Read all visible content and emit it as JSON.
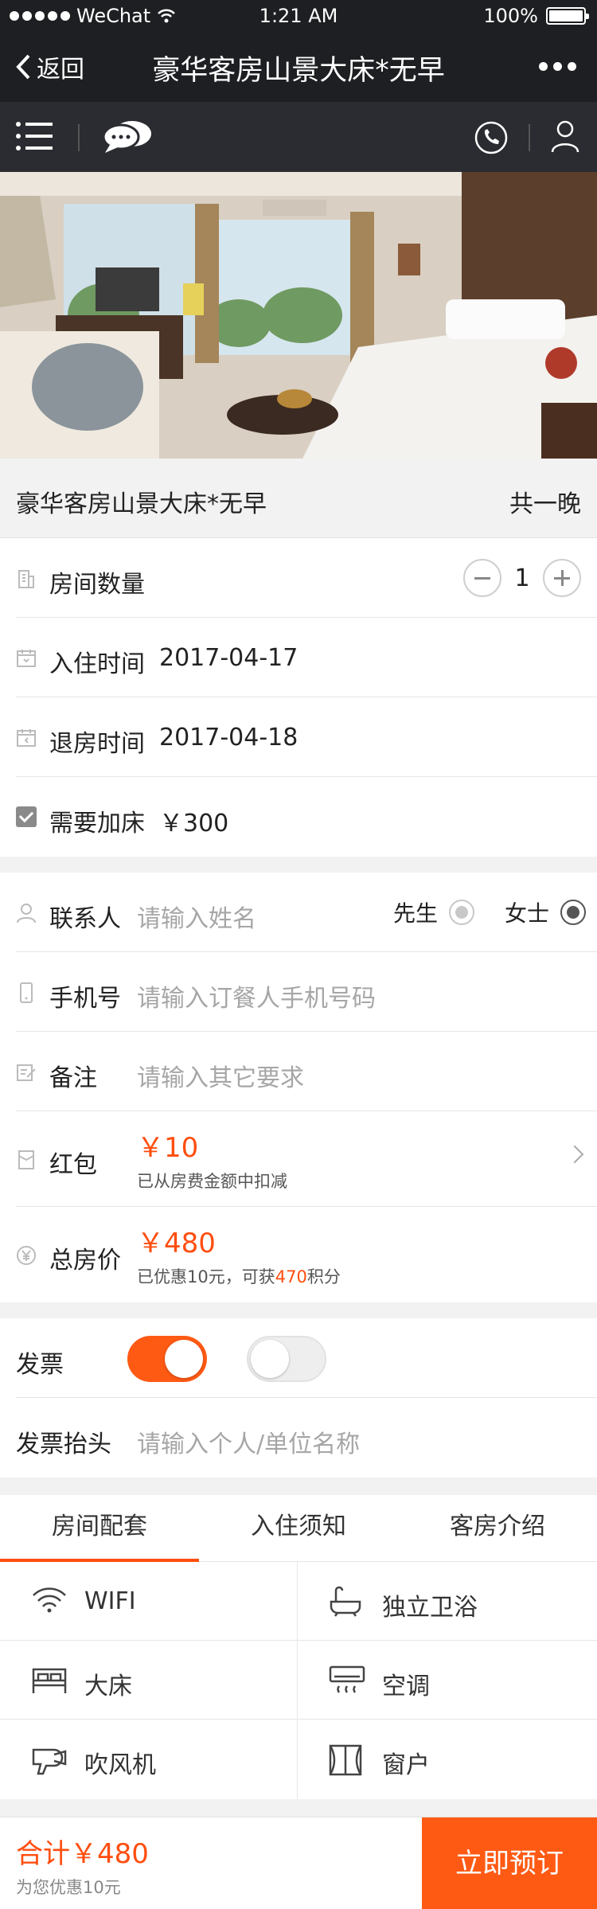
{
  "status": {
    "carrier": "WeChat",
    "time": "1:21 AM",
    "battery": "100%"
  },
  "nav": {
    "back_label": "返回",
    "title": "豪华客房山景大床*无早"
  },
  "room": {
    "name": "豪华客房山景大床*无早",
    "nights": "共一晚"
  },
  "booking": {
    "quantity_label": "房间数量",
    "quantity": "1",
    "checkin_label": "入住时间",
    "checkin_date": "2017-04-17",
    "checkout_label": "退房时间",
    "checkout_date": "2017-04-18",
    "extra_bed_label": "需要加床",
    "extra_bed_price": "￥300",
    "extra_bed_checked": true
  },
  "contact": {
    "name_label": "联系人",
    "name_placeholder": "请输入姓名",
    "gender_male": "先生",
    "gender_female": "女士",
    "gender_selected": "女士",
    "phone_label": "手机号",
    "phone_placeholder": "请输入订餐人手机号码",
    "note_label": "备注",
    "note_placeholder": "请输入其它要求",
    "coupon_label": "红包",
    "coupon_amount": "￥10",
    "coupon_note": "已从房费金额中扣减",
    "total_label": "总房价",
    "total_amount": "￥480",
    "total_note_prefix": "已优惠10元，可获",
    "total_points": "470",
    "total_note_suffix": "积分"
  },
  "invoice": {
    "label": "发票",
    "toggle1_on": true,
    "toggle2_on": false,
    "title_label": "发票抬头",
    "title_placeholder": "请输入个人/单位名称"
  },
  "tabs": [
    {
      "label": "房间配套",
      "active": true
    },
    {
      "label": "入住须知",
      "active": false
    },
    {
      "label": "客房介绍",
      "active": false
    }
  ],
  "amenities": [
    {
      "label": "WIFI",
      "icon": "wifi-icon"
    },
    {
      "label": "独立卫浴",
      "icon": "bathtub-icon"
    },
    {
      "label": "大床",
      "icon": "bed-icon"
    },
    {
      "label": "空调",
      "icon": "air-conditioner-icon"
    },
    {
      "label": "吹风机",
      "icon": "hair-dryer-icon"
    },
    {
      "label": "窗户",
      "icon": "window-icon"
    }
  ],
  "footer": {
    "total_label": "合计",
    "total": "￥480",
    "discount": "为您优惠10元",
    "book_label": "立即预订"
  },
  "colors": {
    "accent": "#ff4e0f",
    "header": "#1d1f22",
    "toolbar": "#2a2c31"
  }
}
